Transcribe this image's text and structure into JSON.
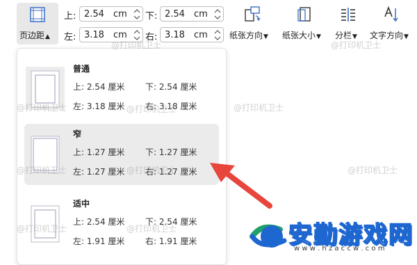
{
  "toolbar": {
    "margins_button": "页边距",
    "top_label": "上:",
    "top_value": "2.54",
    "bottom_label": "下:",
    "bottom_value": "2.54",
    "left_label": "左:",
    "left_value": "3.18",
    "right_label": "右:",
    "right_value": "3.18",
    "unit": "cm",
    "orientation": "纸张方向",
    "size": "纸张大小",
    "columns": "分栏",
    "text_direction": "文字方向"
  },
  "presets": [
    {
      "name": "普通",
      "top": "上: 2.54 厘米",
      "bottom": "下: 2.54 厘米",
      "left": "左: 3.18 厘米",
      "right": "右: 3.18 厘米"
    },
    {
      "name": "窄",
      "top": "上: 1.27 厘米",
      "bottom": "下: 1.27 厘米",
      "left": "左: 1.27 厘米",
      "right": "右: 1.27 厘米"
    },
    {
      "name": "适中",
      "top": "上: 2.54 厘米",
      "bottom": "下: 2.54 厘米",
      "left": "左: 1.91 厘米",
      "right": "右: 1.91 厘米"
    }
  ],
  "watermark": "@打印机卫士",
  "logo": {
    "title": "安勤游戏网",
    "url": "w w w . h z a c c w . c o m"
  },
  "colors": {
    "accent": "#2f6fd6",
    "arrow": "#e8453c",
    "logo_blue": "#1e66d0",
    "logo_green": "#22a06b"
  }
}
